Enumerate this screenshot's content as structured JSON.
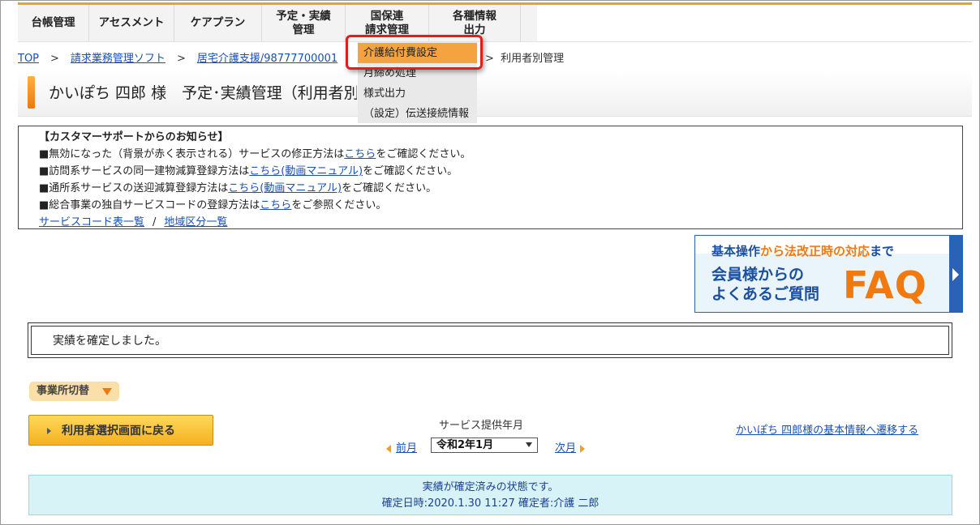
{
  "nav": {
    "items": [
      {
        "label": "台帳管理",
        "width": 88
      },
      {
        "label": "アセスメント",
        "width": 105
      },
      {
        "label": "ケアプラン",
        "width": 108
      },
      {
        "label": "予定・実績\n管理",
        "width": 103
      },
      {
        "label": "国保連\n請求管理",
        "width": 103
      },
      {
        "label": "各種情報\n出力",
        "width": 113
      }
    ]
  },
  "breadcrumb": {
    "items": [
      "TOP",
      "請求業務管理ソフト",
      "居宅介護支援/98777700001"
    ],
    "current": "利用者別管理"
  },
  "page_title": "かいぽち 四郎 様　予定･実績管理（利用者別）",
  "dropdown": {
    "items": [
      "介護給付費設定",
      "月締め処理",
      "様式出力",
      "（設定）伝送接続情報"
    ]
  },
  "notice": {
    "heading": "【カスタマーサポートからのお知らせ】",
    "lines": [
      {
        "pre": "■無効になった（背景が赤く表示される）サービスの修正方法は",
        "link": "こちら",
        "post": "をご確認ください。"
      },
      {
        "pre": "■訪問系サービスの同一建物減算登録方法は",
        "link": "こちら(動画マニュアル)",
        "post": "をご確認ください。"
      },
      {
        "pre": "■通所系サービスの送迎減算登録方法は",
        "link": "こちら(動画マニュアル)",
        "post": "をご確認ください。"
      },
      {
        "pre": "■総合事業の独自サービスコードの登録方法は",
        "link": "こちら",
        "post": "をご参照ください。"
      }
    ],
    "link_a": "サービスコード表一覧",
    "link_sep": "/",
    "link_b": "地域区分一覧"
  },
  "faq": {
    "line1_a": "基本操作",
    "line1_b": "から",
    "line1_c": "法改正時の対応",
    "line1_d": "まで",
    "line2": "会員様からの",
    "line3": "よくあるご質問",
    "big": "FAQ"
  },
  "message": "実績を確定しました。",
  "switch_label": "事業所切替",
  "back_button": "利用者選択画面に戻る",
  "month": {
    "label": "サービス提供年月",
    "prev": "前月",
    "selected": "令和2年1月",
    "next": "次月"
  },
  "basic_info_link": "かいぽち 四郎様の基本情報へ遷移する",
  "status": {
    "line1": "実績が確定済みの状態です。",
    "line2": "確定日時:2020.1.30 11:27  確定者:介護 二郎"
  },
  "colors": {
    "accent": "#f0a020",
    "link": "#1a4fb3",
    "highlight": "#e01e1e",
    "faq_blue": "#1b4fa0",
    "faq_orange": "#f07a10"
  }
}
